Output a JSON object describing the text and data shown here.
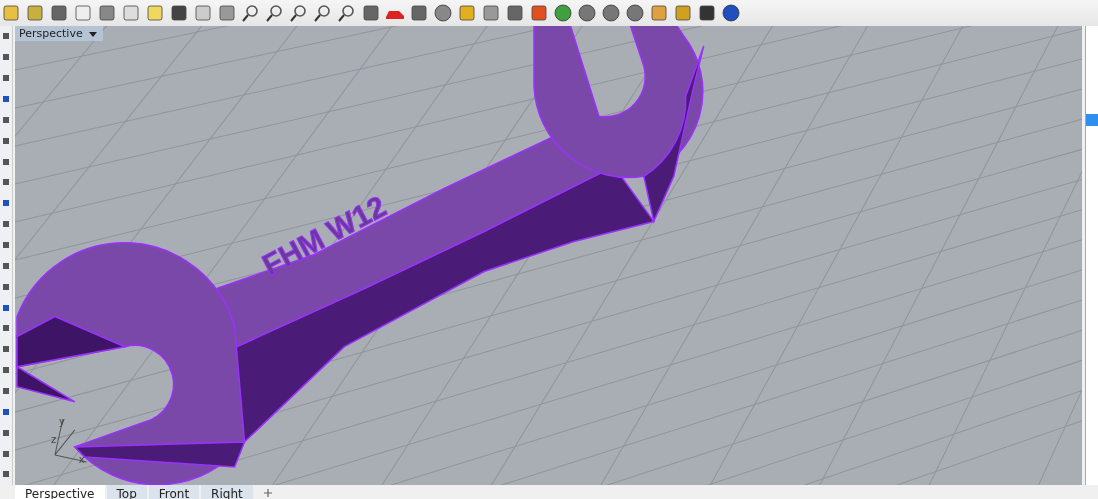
{
  "viewport": {
    "title": "Perspective",
    "model_text": "FHM W12",
    "axes": [
      "y",
      "z",
      "x"
    ]
  },
  "tabs": [
    {
      "label": "Perspective",
      "selected": true
    },
    {
      "label": "Top",
      "selected": false
    },
    {
      "label": "Front",
      "selected": false
    },
    {
      "label": "Right",
      "selected": false
    }
  ]
}
